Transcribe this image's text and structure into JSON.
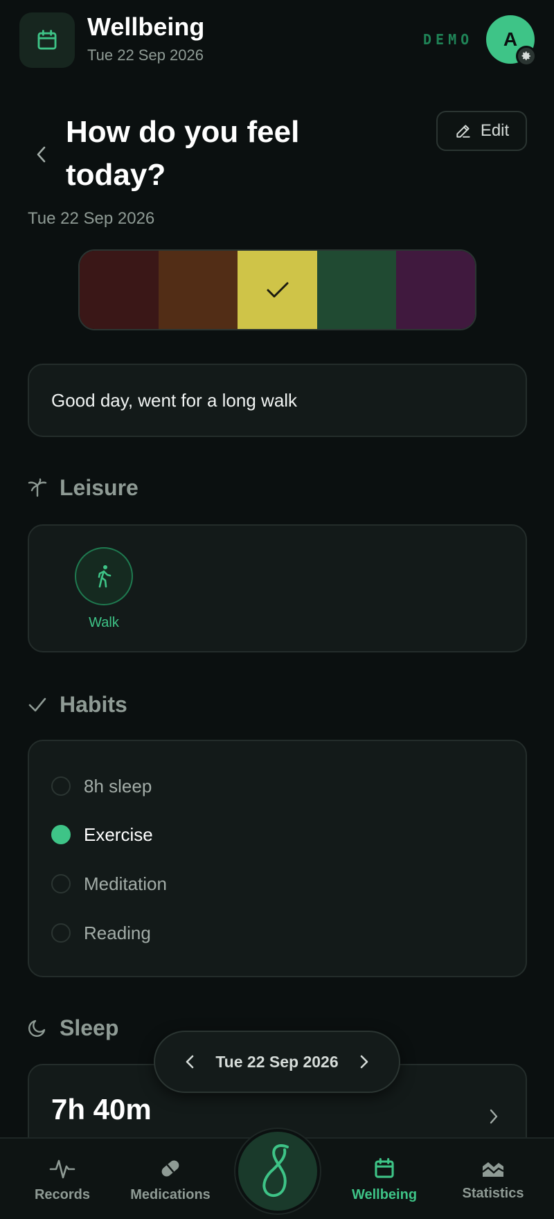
{
  "header": {
    "app_title": "Wellbeing",
    "app_date": "Tue 22 Sep 2026",
    "demo_label": "DEMO",
    "avatar_initial": "A",
    "app_icon": "calendar-icon",
    "gear_icon": "gear-icon"
  },
  "question": {
    "title": "How do you feel today?",
    "date": "Tue 22 Sep 2026",
    "edit_label": "Edit",
    "back_icon": "chevron-left-icon",
    "edit_icon": "pencil-icon"
  },
  "moods": [
    {
      "color": "#3a1717",
      "selected": false
    },
    {
      "color": "#522d16",
      "selected": false
    },
    {
      "color": "#cfc448",
      "selected": true
    },
    {
      "color": "#204a32",
      "selected": false
    },
    {
      "color": "#40193e",
      "selected": false
    }
  ],
  "note": {
    "text": "Good day, went for a long walk"
  },
  "leisure": {
    "heading": "Leisure",
    "heading_icon": "palm-tree-icon",
    "activities": [
      {
        "label": "Walk",
        "icon": "walking-person-icon"
      }
    ]
  },
  "habits": {
    "heading": "Habits",
    "heading_icon": "check-icon",
    "items": [
      {
        "label": "8h sleep",
        "checked": false
      },
      {
        "label": "Exercise",
        "checked": true
      },
      {
        "label": "Meditation",
        "checked": false
      },
      {
        "label": "Reading",
        "checked": false
      }
    ]
  },
  "sleep": {
    "heading": "Sleep",
    "heading_icon": "moon-icon",
    "duration": "7h 40m"
  },
  "date_pill": {
    "text": "Tue 22 Sep 2026"
  },
  "nav": {
    "items": [
      {
        "label": "Records",
        "icon": "activity-pulse-icon",
        "active": false
      },
      {
        "label": "Medications",
        "icon": "pill-icon",
        "active": false
      },
      {
        "label": "Wellbeing",
        "icon": "calendar-icon",
        "active": true
      },
      {
        "label": "Statistics",
        "icon": "chart-area-icon",
        "active": false
      }
    ],
    "home_icon": "infinity-logo-icon"
  },
  "colors": {
    "accent": "#3ec487",
    "background": "#0b1010",
    "card": "#131a19"
  }
}
